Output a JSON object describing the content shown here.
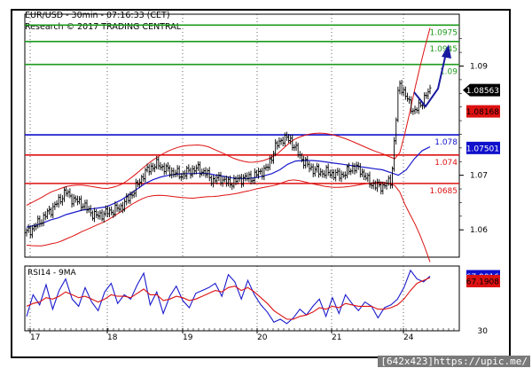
{
  "header": {
    "title": "EUR/USD - 30min - 07:16:33 (CET)",
    "copyright": "Research © 2017 TRADING CENTRAL"
  },
  "watermark": "[642x423]https://upic.me/",
  "chart_data": [
    {
      "type": "line",
      "title": "EUR/USD - 30min - 07:16:33 (CET)",
      "ylim": [
        1.055,
        1.0995
      ],
      "x": [
        "17",
        "18",
        "19",
        "20",
        "21",
        "24"
      ],
      "y_ticks": [
        "1.06",
        "1.07",
        "1.09"
      ],
      "horizontal_levels": [
        {
          "label": "1.0975",
          "value": 1.0975,
          "color": "#1c9a1c"
        },
        {
          "label": "1.0945",
          "value": 1.0945,
          "color": "#1c9a1c"
        },
        {
          "label": "1.09",
          "value": 1.0903,
          "color": "#1c9a1c"
        },
        {
          "label": "1.078",
          "value": 1.0774,
          "color": "#1010cc"
        },
        {
          "label": "1.074",
          "value": 1.0737,
          "color": "#dd1111"
        },
        {
          "label": "1.0685",
          "value": 1.0685,
          "color": "#dd1111"
        }
      ],
      "price_tags": [
        {
          "label": "1.08563",
          "value": 1.0856,
          "color": "#000000",
          "text_color": "#ffffff",
          "style": "arrow"
        },
        {
          "label": "1.08168",
          "value": 1.0817,
          "color": "#dd1111",
          "text_color": "#000000",
          "style": "box"
        },
        {
          "label": "1.07501",
          "value": 1.075,
          "color": "#1010cc",
          "text_color": "#ffffff",
          "style": "box"
        }
      ],
      "series": [
        {
          "color": "#000000",
          "values": [
            1.0595,
            1.0605,
            1.062,
            1.0635,
            1.065,
            1.067,
            1.0655,
            1.065,
            1.0635,
            1.0625,
            1.063,
            1.0635,
            1.064,
            1.0655,
            1.0675,
            1.07,
            1.0715,
            1.072,
            1.071,
            1.0705,
            1.07,
            1.0708,
            1.0712,
            1.0705,
            1.069,
            1.0695,
            1.0685,
            1.069,
            1.0695,
            1.0695,
            1.0705,
            1.0712,
            1.075,
            1.0768,
            1.0765,
            1.074,
            1.072,
            1.071,
            1.0705,
            1.0705,
            1.07,
            1.0702,
            1.0715,
            1.071,
            1.069,
            1.068,
            1.068,
            1.069,
            1.0872,
            1.084,
            1.0815,
            1.0835,
            1.0856
          ]
        },
        {
          "color": "#1a1acc",
          "values": [
            1.0605,
            1.0608,
            1.0612,
            1.0618,
            1.0622,
            1.0628,
            1.0632,
            1.0636,
            1.0638,
            1.064,
            1.0642,
            1.0648,
            1.0655,
            1.0665,
            1.0675,
            1.0685,
            1.0692,
            1.0697,
            1.07,
            1.0702,
            1.0703,
            1.0703,
            1.0704,
            1.0703,
            1.07,
            1.0698,
            1.0695,
            1.0694,
            1.0694,
            1.0696,
            1.0699,
            1.0703,
            1.071,
            1.072,
            1.0726,
            1.0727,
            1.0727,
            1.0726,
            1.0724,
            1.0722,
            1.072,
            1.0718,
            1.0716,
            1.0714,
            1.0712,
            1.071,
            1.0705,
            1.07,
            1.071,
            1.073,
            1.0745,
            1.0752
          ]
        }
      ]
    },
    {
      "type": "line",
      "title": "RSI14 - 9MA",
      "ylim": [
        30,
        75
      ],
      "y_ticks": [
        "30"
      ],
      "x": [
        "17",
        "18",
        "19",
        "20",
        "21",
        "24"
      ],
      "price_tags": [
        {
          "label": "67.9016",
          "value": 67.9,
          "color": "#1010cc",
          "text_color": "#ffffff"
        },
        {
          "label": "67.1908",
          "value": 64.5,
          "color": "#dd1111",
          "text_color": "#000000"
        }
      ],
      "series": [
        {
          "color": "#1a1acc",
          "values": [
            40,
            55,
            48,
            62,
            45,
            58,
            66,
            52,
            47,
            60,
            50,
            44,
            57,
            63,
            49,
            55,
            52,
            62,
            70,
            48,
            57,
            42,
            54,
            61,
            51,
            46,
            56,
            58,
            60,
            63,
            54,
            69,
            64,
            52,
            65,
            55,
            48,
            43,
            36,
            38,
            35,
            39,
            45,
            41,
            47,
            52,
            40,
            53,
            42,
            55,
            49,
            44,
            50,
            47,
            39,
            46,
            48,
            52,
            60,
            72,
            66,
            64,
            68
          ]
        },
        {
          "color": "#dd1111",
          "values": [
            47,
            49,
            50,
            53,
            52,
            54,
            57,
            55,
            53,
            54,
            52,
            50,
            52,
            55,
            54,
            54,
            53,
            56,
            59,
            55,
            55,
            51,
            52,
            54,
            53,
            51,
            52,
            54,
            56,
            58,
            57,
            60,
            61,
            58,
            60,
            57,
            53,
            49,
            44,
            41,
            38,
            38,
            40,
            41,
            43,
            46,
            45,
            47,
            46,
            49,
            48,
            47,
            47,
            47,
            45,
            45,
            46,
            48,
            52,
            58,
            63,
            65,
            67
          ]
        }
      ]
    }
  ]
}
